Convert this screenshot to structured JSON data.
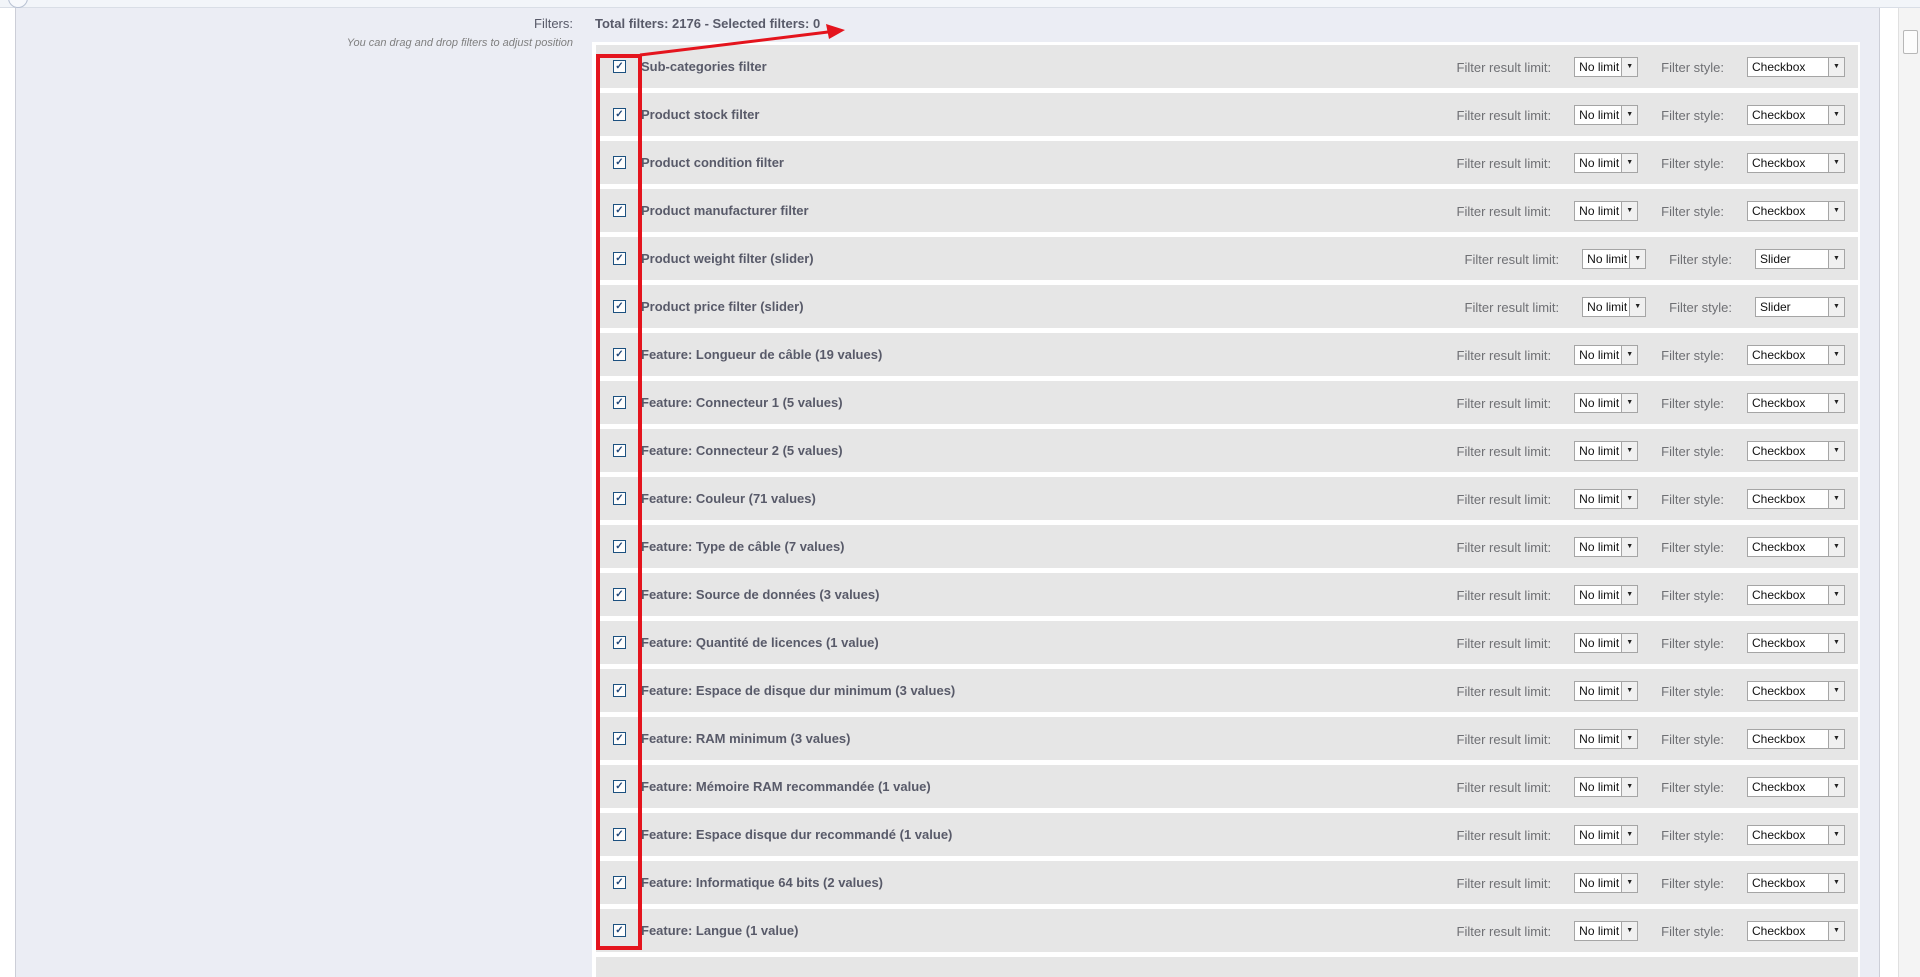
{
  "page": {
    "filters_label": "Filters:",
    "drag_hint": "You can drag and drop filters to adjust position",
    "summary": "Total filters: 2176 - Selected filters: 0"
  },
  "labels": {
    "limit": "Filter result limit:",
    "style": "Filter style:"
  },
  "filters": [
    {
      "name": "Sub-categories filter",
      "checked": true,
      "limit": "No limit",
      "style": "Checkbox"
    },
    {
      "name": "Product stock filter",
      "checked": true,
      "limit": "No limit",
      "style": "Checkbox"
    },
    {
      "name": "Product condition filter",
      "checked": true,
      "limit": "No limit",
      "style": "Checkbox"
    },
    {
      "name": "Product manufacturer filter",
      "checked": true,
      "limit": "No limit",
      "style": "Checkbox"
    },
    {
      "name": "Product weight filter (slider)",
      "checked": true,
      "limit": "No limit",
      "style": "Slider"
    },
    {
      "name": "Product price filter (slider)",
      "checked": true,
      "limit": "No limit",
      "style": "Slider"
    },
    {
      "name": "Feature: Longueur de câble (19 values)",
      "checked": true,
      "limit": "No limit",
      "style": "Checkbox"
    },
    {
      "name": "Feature: Connecteur 1 (5 values)",
      "checked": true,
      "limit": "No limit",
      "style": "Checkbox"
    },
    {
      "name": "Feature: Connecteur 2 (5 values)",
      "checked": true,
      "limit": "No limit",
      "style": "Checkbox"
    },
    {
      "name": "Feature: Couleur (71 values)",
      "checked": true,
      "limit": "No limit",
      "style": "Checkbox"
    },
    {
      "name": "Feature: Type de câble (7 values)",
      "checked": true,
      "limit": "No limit",
      "style": "Checkbox"
    },
    {
      "name": "Feature: Source de données (3 values)",
      "checked": true,
      "limit": "No limit",
      "style": "Checkbox"
    },
    {
      "name": "Feature: Quantité de licences (1 value)",
      "checked": true,
      "limit": "No limit",
      "style": "Checkbox"
    },
    {
      "name": "Feature: Espace de disque dur minimum (3 values)",
      "checked": true,
      "limit": "No limit",
      "style": "Checkbox"
    },
    {
      "name": "Feature: RAM minimum (3 values)",
      "checked": true,
      "limit": "No limit",
      "style": "Checkbox"
    },
    {
      "name": "Feature: Mémoire RAM recommandée (1 value)",
      "checked": true,
      "limit": "No limit",
      "style": "Checkbox"
    },
    {
      "name": "Feature: Espace disque dur recommandé (1 value)",
      "checked": true,
      "limit": "No limit",
      "style": "Checkbox"
    },
    {
      "name": "Feature: Informatique 64 bits (2 values)",
      "checked": true,
      "limit": "No limit",
      "style": "Checkbox"
    },
    {
      "name": "Feature: Langue (1 value)",
      "checked": true,
      "limit": "No limit",
      "style": "Checkbox"
    }
  ],
  "icons": {
    "checkbox_tick": "✓",
    "dropdown_arrow": "▼"
  },
  "colors": {
    "annotation": "#e4141d",
    "row_bg": "#e6e6e6",
    "panel_bg": "#ebedf4"
  }
}
